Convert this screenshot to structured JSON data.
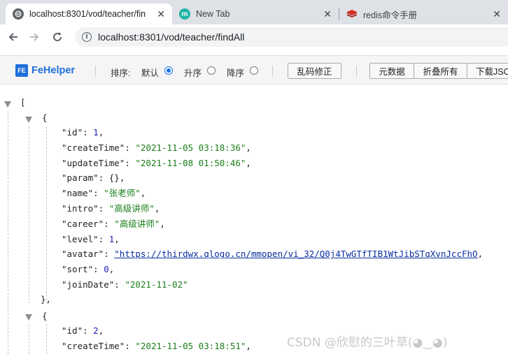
{
  "tabs": [
    {
      "title": "localhost:8301/vod/teacher/fin",
      "icon": "globe-icon",
      "close": "✕"
    },
    {
      "title": "New Tab",
      "icon": "m-logo-icon",
      "close": "✕"
    },
    {
      "title": "redis命令手册",
      "icon": "redis-icon",
      "close": "✕"
    }
  ],
  "address_bar": {
    "host": "localhost",
    "rest": ":8301/vod/teacher/findAll"
  },
  "fehelper": {
    "logo_badge": "FE",
    "logo_text": "FeHelper",
    "sort_label": "排序:",
    "sort_options": [
      {
        "label": "默认",
        "selected": true
      },
      {
        "label": "升序",
        "selected": false
      },
      {
        "label": "降序",
        "selected": false
      }
    ],
    "fix_encoding_button": "乱码修正",
    "metadata_button": "元数据",
    "fold_all_button": "折叠所有",
    "download_button": "下载JSON"
  },
  "json_viewer": {
    "open_bracket": "[",
    "records": [
      {
        "open": "{",
        "fields": [
          {
            "key": "\"id\"",
            "value": "1",
            "type": "number"
          },
          {
            "key": "\"createTime\"",
            "value": "\"2021-11-05 03:18:36\"",
            "type": "string"
          },
          {
            "key": "\"updateTime\"",
            "value": "\"2021-11-08 01:50:46\"",
            "type": "string"
          },
          {
            "key": "\"param\"",
            "value": "{}",
            "type": "object"
          },
          {
            "key": "\"name\"",
            "value": "\"张老师\"",
            "type": "string"
          },
          {
            "key": "\"intro\"",
            "value": "\"高级讲师\"",
            "type": "string"
          },
          {
            "key": "\"career\"",
            "value": "\"高级讲师\"",
            "type": "string"
          },
          {
            "key": "\"level\"",
            "value": "1",
            "type": "number"
          },
          {
            "key": "\"avatar\"",
            "value": "\"https://thirdwx.qlogo.cn/mmopen/vi_32/Q0j4TwGTfTIB1WtJibSTqXvnJccFhO",
            "type": "link"
          },
          {
            "key": "\"sort\"",
            "value": "0",
            "type": "number"
          },
          {
            "key": "\"joinDate\"",
            "value": "\"2021-11-02\"",
            "type": "string"
          }
        ],
        "close": "},"
      },
      {
        "open": "{",
        "fields": [
          {
            "key": "\"id\"",
            "value": "2",
            "type": "number"
          },
          {
            "key": "\"createTime\"",
            "value": "\"2021-11-05 03:18:51\"",
            "type": "string"
          }
        ]
      }
    ]
  },
  "watermark": "CSDN @欣慰的三叶草(◕‿◕)",
  "colors": {
    "string": "#1a7f1a",
    "number": "#1d1db4",
    "link": "#0b2ea0",
    "fehelper_blue": "#1e6fd9"
  }
}
